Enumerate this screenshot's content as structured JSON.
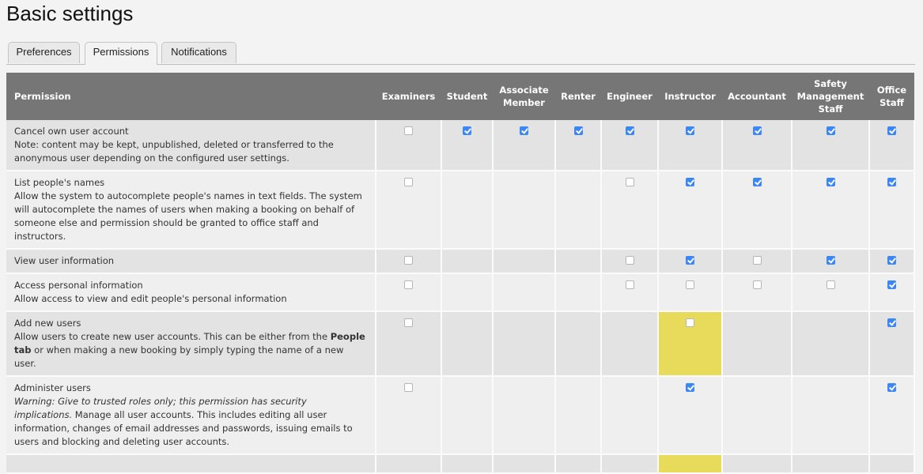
{
  "page": {
    "title": "Basic settings"
  },
  "tabs": [
    {
      "label": "Preferences",
      "active": false
    },
    {
      "label": "Permissions",
      "active": true
    },
    {
      "label": "Notifications",
      "active": false
    }
  ],
  "table": {
    "permission_header": "Permission",
    "roles": [
      "Examiners",
      "Student",
      "Associate Member",
      "Renter",
      "Engineer",
      "Instructor",
      "Accountant",
      "Safety Management Staff",
      "Office Staff"
    ],
    "rows": [
      {
        "title": "Cancel own user account",
        "desc": [
          {
            "t": "Note: content may be kept, unpublished, deleted or transferred to the anonymous user depending on the configured user settings."
          }
        ],
        "cells": [
          "off",
          "on",
          "on",
          "on",
          "on",
          "on",
          "on",
          "on",
          "on"
        ]
      },
      {
        "title": "List people's names",
        "desc": [
          {
            "t": "Allow the system to autocomplete people's names in text fields. The system will autocomplete the names of users when making a booking on behalf of someone else and permission should be granted to office staff and instructors."
          }
        ],
        "cells": [
          "off",
          "none",
          "none",
          "none",
          "off",
          "on",
          "on",
          "on",
          "on"
        ]
      },
      {
        "title": "View user information",
        "desc": [],
        "cells": [
          "off",
          "none",
          "none",
          "none",
          "off",
          "on",
          "off",
          "on",
          "on"
        ]
      },
      {
        "title": "Access personal information",
        "desc": [
          {
            "t": "Allow access to view and edit people's personal information"
          }
        ],
        "cells": [
          "off",
          "none",
          "none",
          "none",
          "off",
          "off",
          "off",
          "off",
          "on"
        ]
      },
      {
        "title": "Add new users",
        "desc": [
          {
            "t": "Allow users to create new user accounts. This can be either from the "
          },
          {
            "t": "People tab",
            "b": true
          },
          {
            "t": " or when making a new booking by simply typing the name of a new user."
          }
        ],
        "cells": [
          "off",
          "none",
          "none",
          "none",
          "none",
          "off",
          "none",
          "none",
          "on"
        ],
        "highlight_col": 5
      },
      {
        "title": "Administer users",
        "desc": [
          {
            "t": "Warning: Give to trusted roles only; this permission has security implications.",
            "i": true
          },
          {
            "t": " Manage all user accounts. This includes editing all user information, changes of email addresses and passwords, issuing emails to users and blocking and deleting user accounts."
          }
        ],
        "cells": [
          "off",
          "none",
          "none",
          "none",
          "none",
          "on",
          "none",
          "none",
          "on"
        ]
      },
      {
        "title": "",
        "desc": [],
        "cells": [
          "none",
          "none",
          "none",
          "none",
          "none",
          "none",
          "none",
          "none",
          "none"
        ],
        "highlight_col": 5
      }
    ]
  },
  "colors": {
    "header_bg": "#767676",
    "checkbox_checked": "#3c87f5",
    "highlight": "#e8da5a"
  }
}
